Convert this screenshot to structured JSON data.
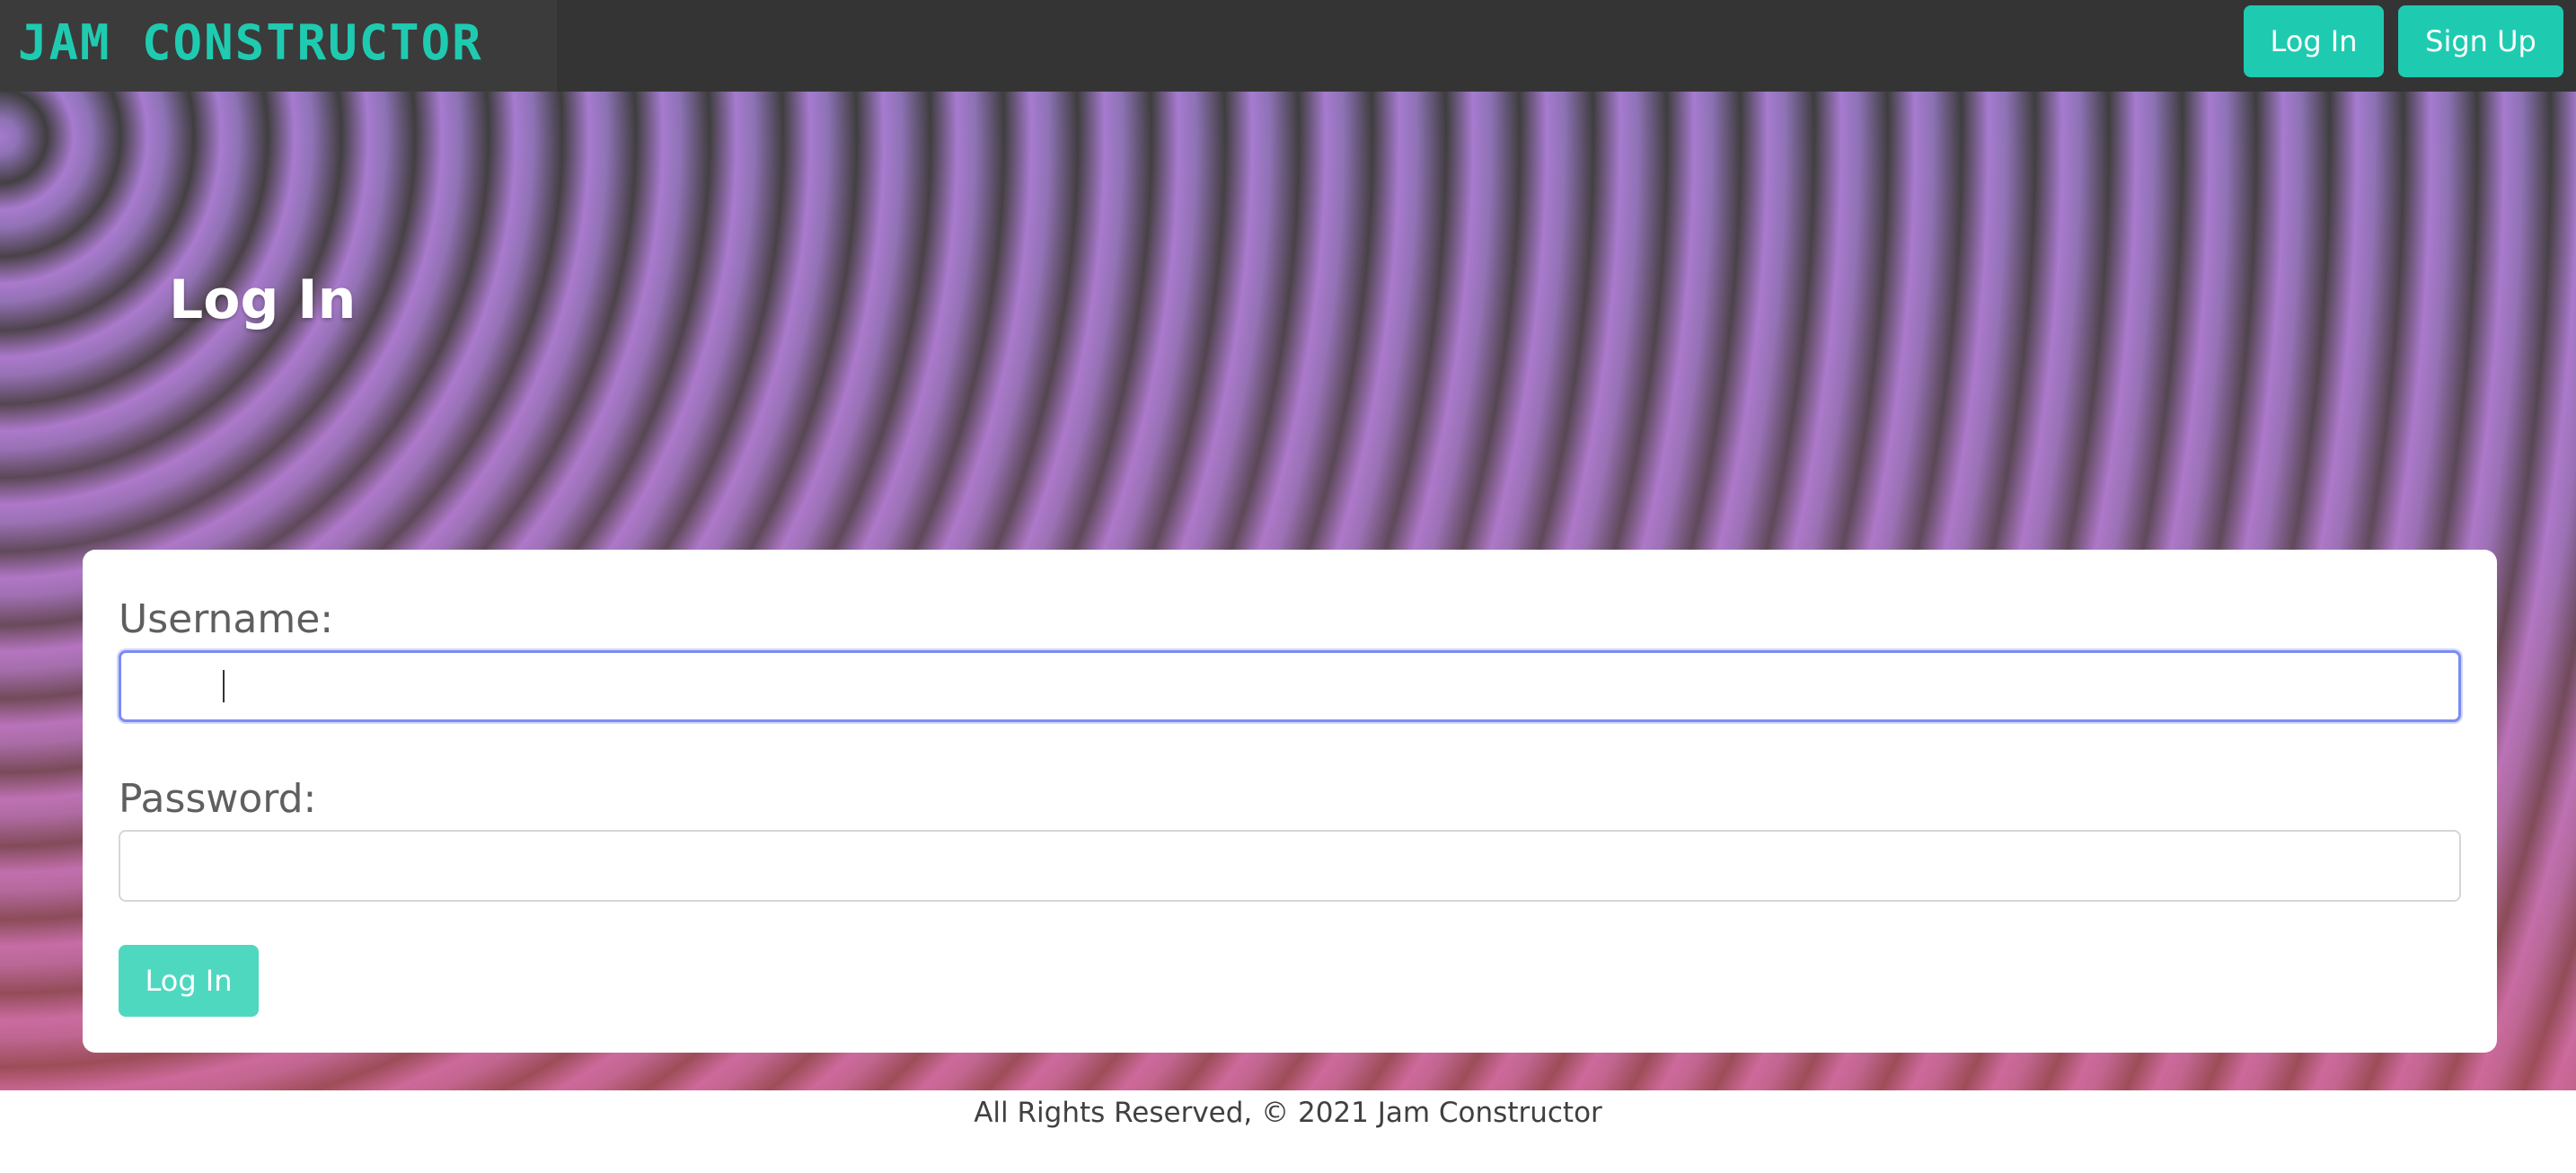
{
  "navbar": {
    "brand": "JAM CONSTRUCTOR",
    "login_label": "Log In",
    "signup_label": "Sign Up"
  },
  "page": {
    "heading": "Log In"
  },
  "form": {
    "username_label": "Username:",
    "username_value": "",
    "password_label": "Password:",
    "password_value": "",
    "submit_label": "Log In"
  },
  "footer": {
    "text": "All Rights Reserved, © 2021 Jam Constructor"
  },
  "colors": {
    "accent": "#1fcbb0",
    "navbar_bg": "#343434",
    "focus_border": "#7b8df0"
  }
}
